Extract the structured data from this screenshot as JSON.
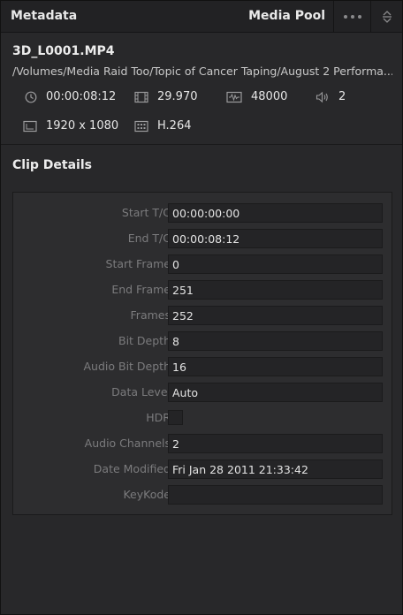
{
  "header": {
    "title": "Metadata",
    "media_pool": "Media Pool",
    "more_icon": "more-dots-icon",
    "sort_icon": "expand-collapse-icon"
  },
  "clip": {
    "name": "3D_L0001.MP4",
    "path": "/Volumes/Media Raid Too/Topic of Cancer Taping/August 2 Performa...",
    "duration": "00:00:08:12",
    "fps": "29.970",
    "audio_rate": "48000",
    "audio_channels": "2",
    "resolution": "1920 x 1080",
    "codec": "H.264"
  },
  "details": {
    "title": "Clip Details",
    "rows": [
      {
        "label": "Start T/C",
        "value": "00:00:00:00"
      },
      {
        "label": "End T/C",
        "value": "00:00:08:12"
      },
      {
        "label": "Start Frame",
        "value": "0"
      },
      {
        "label": "End Frame",
        "value": "251"
      },
      {
        "label": "Frames",
        "value": "252"
      },
      {
        "label": "Bit Depth",
        "value": "8"
      },
      {
        "label": "Audio Bit Depth",
        "value": "16"
      },
      {
        "label": "Data Level",
        "value": "Auto"
      },
      {
        "label": "HDR",
        "value": ""
      },
      {
        "label": "Audio Channels",
        "value": "2"
      },
      {
        "label": "Date Modified",
        "value": "Fri Jan 28 2011 21:33:42"
      },
      {
        "label": "KeyKode",
        "value": ""
      }
    ]
  },
  "colors": {
    "panel": "#28282a",
    "field": "#242426",
    "label": "#7b7b7d",
    "text": "#e4e4e4"
  }
}
